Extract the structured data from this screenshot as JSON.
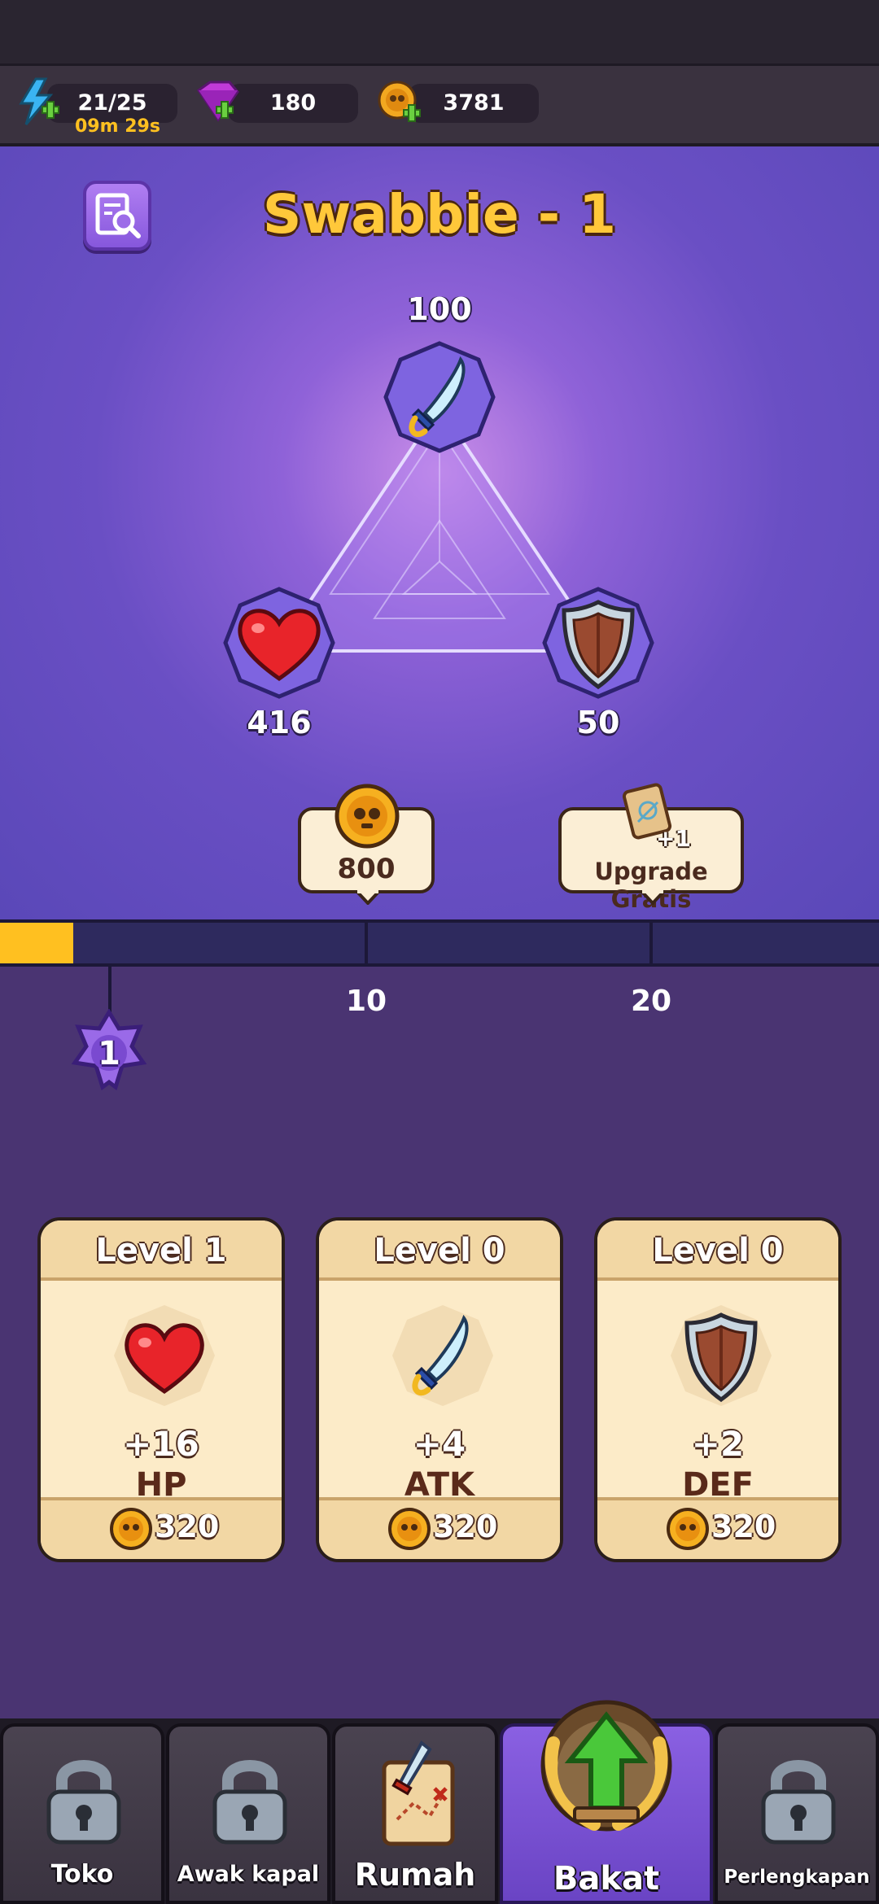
{
  "resources": {
    "energy": {
      "value": "21/25",
      "timer": "09m 29s",
      "icon": "lightning-bolt-icon"
    },
    "gems": {
      "value": "180",
      "icon": "purple-gem-icon"
    },
    "coins": {
      "value": "3781",
      "icon": "skull-coin-icon"
    }
  },
  "hero": {
    "title": "Swabbie - 1",
    "attack": "100",
    "health": "416",
    "defense": "50"
  },
  "upgrade": {
    "coin_cost": "800",
    "free_scroll_count": "+1",
    "free_label": "Upgrade Gratis"
  },
  "progress": {
    "fill_fraction": 0.083,
    "milestones": [
      "10",
      "20"
    ],
    "current_level": "1"
  },
  "cards": [
    {
      "level": "Level 1",
      "bonus": "+16",
      "stat": "HP",
      "cost": "320",
      "icon": "heart-icon"
    },
    {
      "level": "Level 0",
      "bonus": "+4",
      "stat": "ATK",
      "cost": "320",
      "icon": "sword-icon"
    },
    {
      "level": "Level 0",
      "bonus": "+2",
      "stat": "DEF",
      "cost": "320",
      "icon": "shield-icon"
    }
  ],
  "nav": {
    "shop": "Toko",
    "crew": "Awak kapal",
    "home": "Rumah",
    "talent": "Bakat",
    "equipment": "Perlengkapan"
  },
  "colors": {
    "accent": "#ffc83a",
    "hero_bg": "#6a4fc4",
    "page_bg": "#4a3472",
    "progress_fill": "#ffc020",
    "nav_active": "#7b52d6"
  }
}
